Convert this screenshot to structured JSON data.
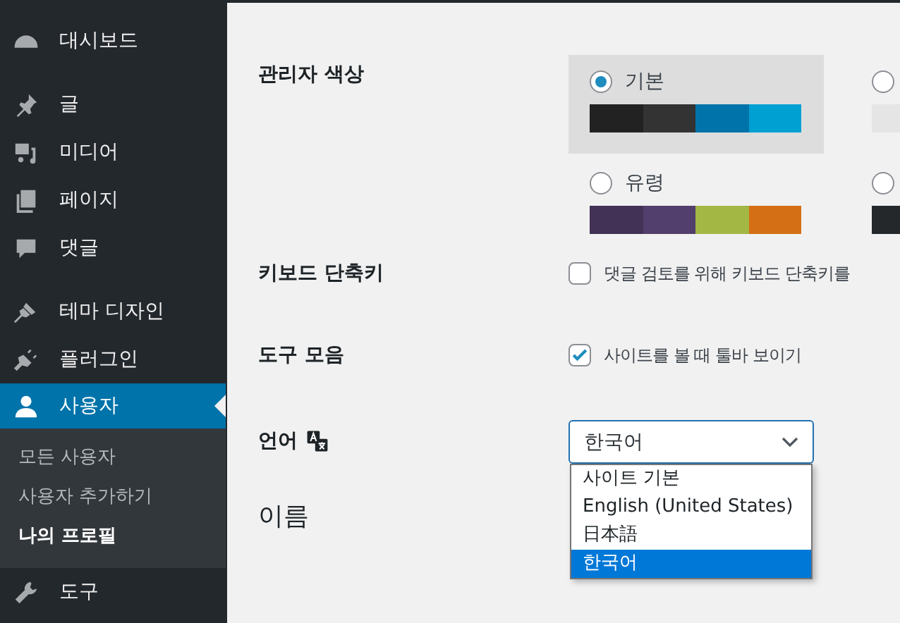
{
  "sidebar": {
    "groups": [
      {
        "items": [
          {
            "label": "대시보드",
            "selected": false
          }
        ]
      },
      {
        "items": [
          {
            "label": "글",
            "selected": false
          },
          {
            "label": "미디어",
            "selected": false
          },
          {
            "label": "페이지",
            "selected": false
          },
          {
            "label": "댓글",
            "selected": false
          }
        ]
      },
      {
        "items": [
          {
            "label": "테마 디자인",
            "selected": false
          },
          {
            "label": "플러그인",
            "selected": false
          },
          {
            "label": "사용자",
            "selected": true,
            "children": [
              {
                "label": "모든 사용자",
                "selected": false
              },
              {
                "label": "사용자 추가하기",
                "selected": false
              },
              {
                "label": "나의 프로필",
                "selected": true
              }
            ]
          },
          {
            "label": "도구",
            "selected": false
          }
        ]
      }
    ]
  },
  "settings": [
    {
      "kind": "schemes",
      "label": "관리자 색상",
      "schemes": [
        {
          "label": "기본",
          "selected": true,
          "swatches": [
            {
              "color": "#222222"
            },
            {
              "color": "#333333"
            },
            {
              "color": "#0073aa"
            },
            {
              "color": "#00a0d2"
            }
          ]
        },
        {
          "selected": false,
          "swatches": [
            {
              "color": "#e5e5e5"
            }
          ]
        },
        {
          "label": "유령",
          "selected": false,
          "swatches": [
            {
              "color": "#413256"
            },
            {
              "color": "#523f6d"
            },
            {
              "color": "#a3b745"
            },
            {
              "color": "#d46f15"
            }
          ]
        },
        {
          "selected": false,
          "swatches": [
            {
              "color": "#25282b"
            }
          ]
        }
      ]
    },
    {
      "kind": "checkbox",
      "label": "키보드 단축키",
      "text": "댓글 검토를 위해 키보드 단축키를",
      "checked": false
    },
    {
      "kind": "checkbox",
      "label": "도구 모음",
      "text": "사이트를 볼 때 툴바 보이기",
      "checked": true
    },
    {
      "kind": "select",
      "label": "언어",
      "value": "한국어",
      "options": [
        {
          "label": "사이트 기본",
          "selected": false
        },
        {
          "label": "English (United States)",
          "selected": false
        },
        {
          "label": "日本語",
          "selected": false
        },
        {
          "label": "한국어",
          "selected": true
        }
      ]
    },
    {
      "kind": "heading",
      "label": "이름"
    }
  ]
}
